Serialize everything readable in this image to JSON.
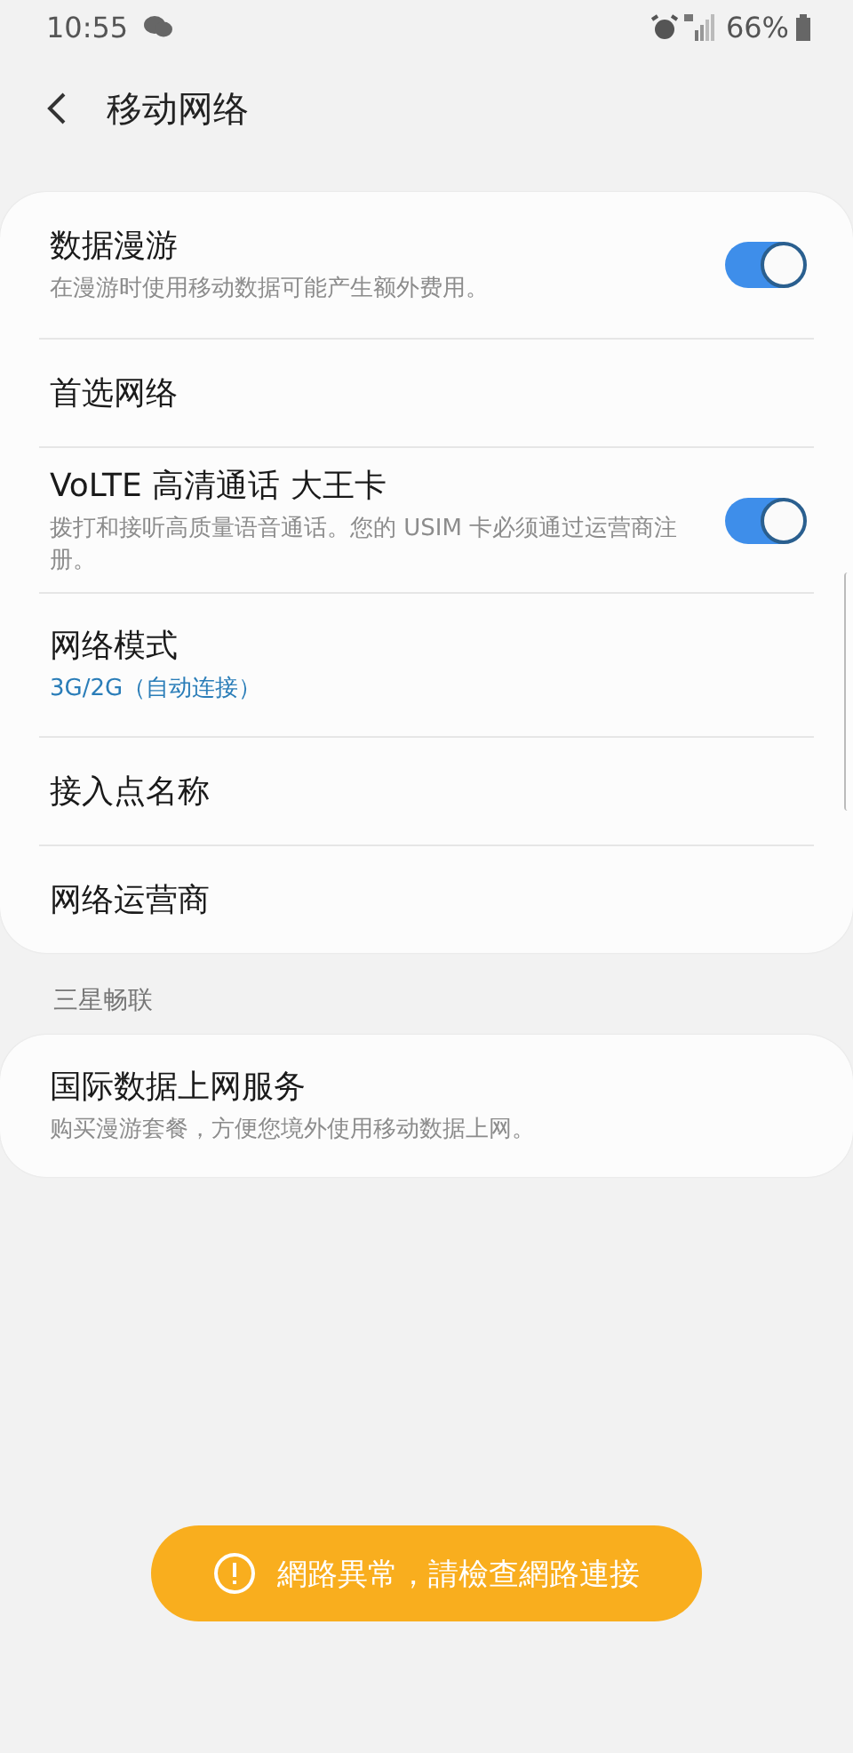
{
  "status_bar": {
    "time": "10:55",
    "battery": "66%"
  },
  "header": {
    "title": "移动网络"
  },
  "settings": [
    {
      "kind": "switch",
      "title": "数据漫游",
      "subtitle": "在漫游时使用移动数据可能产生额外费用。",
      "on": true
    },
    {
      "kind": "plain",
      "title": "首选网络"
    },
    {
      "kind": "switch",
      "title": "VoLTE 高清通话 大王卡",
      "subtitle": "拨打和接听高质量语音通话。您的 USIM 卡必须通过运营商注册。",
      "on": true
    },
    {
      "kind": "value",
      "title": "网络模式",
      "subtitle": "3G/2G（自动连接）"
    },
    {
      "kind": "plain",
      "title": "接入点名称"
    },
    {
      "kind": "plain",
      "title": "网络运营商"
    }
  ],
  "section": {
    "title": "三星畅联",
    "items": [
      {
        "kind": "description",
        "title": "国际数据上网服务",
        "subtitle": "购买漫游套餐，方便您境外使用移动数据上网。"
      }
    ]
  },
  "toast": {
    "message": "網路異常，請檢查網路連接"
  }
}
